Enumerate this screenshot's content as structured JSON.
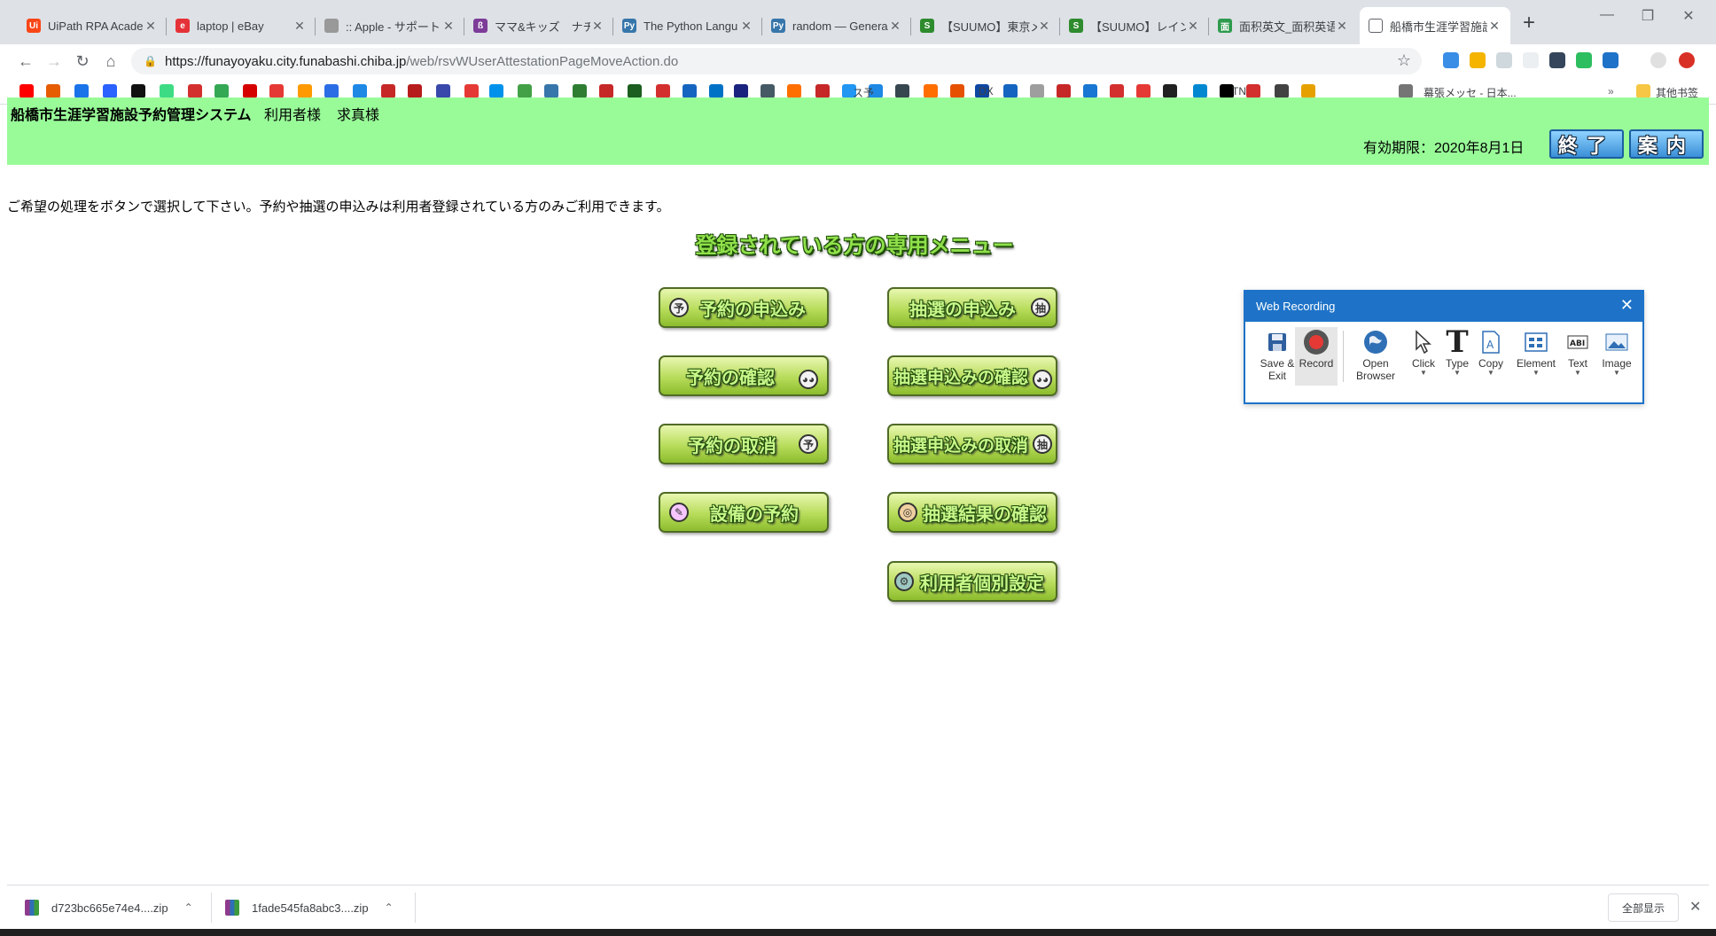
{
  "tabs": [
    {
      "title": "UiPath RPA Acade",
      "favicon": "uipath-icon",
      "color": "#fa4616",
      "glyph": "Ui"
    },
    {
      "title": "laptop | eBay",
      "favicon": "ebay-icon",
      "color": "#e53238",
      "glyph": "e"
    },
    {
      "title": ":: Apple - サポート",
      "favicon": "apple-icon",
      "color": "#999999",
      "glyph": ""
    },
    {
      "title": "ママ&キッズ　ナチ",
      "favicon": "mamakids-icon",
      "color": "#7d3c98",
      "glyph": "ß"
    },
    {
      "title": "The Python Langu",
      "favicon": "python-icon",
      "color": "#3776ab",
      "glyph": "Py"
    },
    {
      "title": "random — Genera",
      "favicon": "python-icon",
      "color": "#3776ab",
      "glyph": "Py"
    },
    {
      "title": "【SUUMO】東京メ",
      "favicon": "suumo-icon",
      "color": "#2e8b2e",
      "glyph": "S"
    },
    {
      "title": "【SUUMO】レイン",
      "favicon": "suumo-icon",
      "color": "#2e8b2e",
      "glyph": "S"
    },
    {
      "title": "面积英文_面积英语",
      "favicon": "dict-icon",
      "color": "#2e9b4e",
      "glyph": "面"
    },
    {
      "title": "船橋市生涯学習施設",
      "favicon": "page-icon",
      "color": "#ffffff",
      "glyph": ""
    }
  ],
  "address": {
    "host": "https://funayoyaku.city.funabashi.chiba.jp",
    "path": "/web/rsvWUserAttestationPageMoveAction.do"
  },
  "bookmarks": {
    "folder_label": "其他书签",
    "items": [
      {
        "text": "ス予"
      },
      {
        "text": "DX"
      },
      {
        "text": "TN"
      },
      {
        "text": "幕張メッセ - 日本..."
      }
    ]
  },
  "header": {
    "system_title": "船橋市生涯学習施設予約管理システム",
    "user_label": "利用者様",
    "user_name": "求真様",
    "validity": "有効期限：2020年8月1日",
    "logout_label": "終了",
    "guide_label": "案内"
  },
  "instruction": "ご希望の処理をボタンで選択して下さい。予約や抽選の申込みは利用者登録されている方のみご利用できます。",
  "menu": {
    "heading": "登録されている方の専用メニュー",
    "buttons": {
      "reserve_apply": "予約の申込み",
      "lottery_apply": "抽選の申込み",
      "reserve_confirm": "予約の確認",
      "lottery_confirm": "抽選申込みの確認",
      "reserve_cancel": "予約の取消",
      "lottery_cancel": "抽選申込みの取消",
      "equipment_reserve": "設備の予約",
      "lottery_result": "抽選結果の確認",
      "user_settings": "利用者個別設定"
    }
  },
  "recorder": {
    "title": "Web Recording",
    "tools": {
      "save_exit": "Save & Exit",
      "record": "Record",
      "open_browser": "Open Browser",
      "click": "Click",
      "type": "Type",
      "copy": "Copy",
      "element": "Element",
      "text": "Text",
      "image": "Image"
    }
  },
  "downloads": {
    "file1": "d723bc665e74e4....zip",
    "file2": "1fade545fa8abc3....zip",
    "show_all": "全部显示"
  }
}
